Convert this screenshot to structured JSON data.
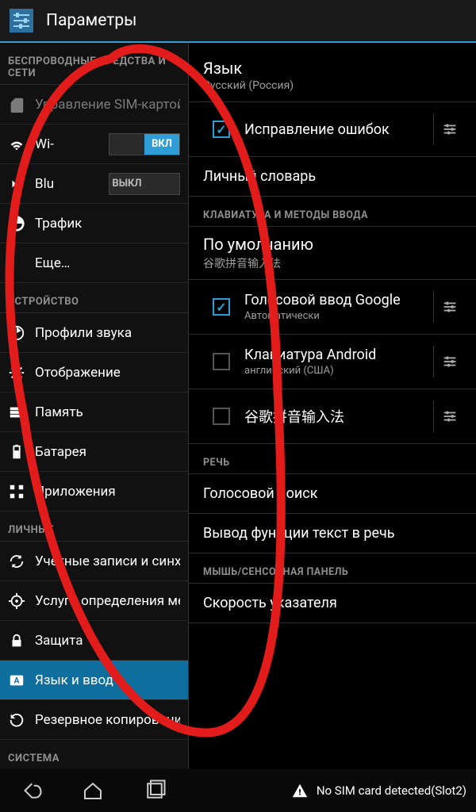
{
  "titlebar": {
    "title": "Параметры"
  },
  "left": {
    "sections": {
      "wireless": "БЕСПРОВОДНЫЕ СРЕДСТВА И СЕТИ",
      "device": "УСТРОЙСТВО",
      "personal": "ЛИЧНЫЕ",
      "system": "СИСТЕМА"
    },
    "items": {
      "sim": "Управление SIM-картой",
      "wifi": "Wi-",
      "wifi_toggle": "ВКЛ",
      "bt": "Blu",
      "bt_toggle": "ВЫКЛ",
      "traffic": "Трафик",
      "more": "Еще…",
      "audio": "Профили звука",
      "display": "Отображение",
      "memory": "Память",
      "battery": "Батарея",
      "apps": "Приложения",
      "accounts": "Учетные записи и синхронизация",
      "location": "Услуги определения местоположения",
      "security": "Защита",
      "language": "Язык и ввод",
      "backup": "Резервное копирование"
    }
  },
  "right": {
    "language": {
      "title": "Язык",
      "subtitle": "Русский (Россия)"
    },
    "spellcheck": "Исправление ошибок",
    "dictionary": "Личный словарь",
    "section_keyboards": "КЛАВИАТУРА И МЕТОДЫ ВВОДА",
    "default": {
      "title": "По умолчанию",
      "subtitle": "谷歌拼音输入法"
    },
    "google_voice": {
      "title": "Голосовой ввод Google",
      "subtitle": "Автоматически"
    },
    "android_kbd": {
      "title": "Клавиатура Android",
      "subtitle": "английский (США)"
    },
    "pinyin": {
      "title": "谷歌拼音输入法"
    },
    "section_speech": "РЕЧЬ",
    "voice_search": "Голосовой поиск",
    "tts": "Вывод функции текст в речь",
    "section_mouse": "МЫШЬ/СЕНСОРНАЯ ПАНЕЛЬ",
    "pointer_speed": "Скорость указателя"
  },
  "navbar": {
    "sim_warning": "No SIM card detected(Slot2)"
  }
}
